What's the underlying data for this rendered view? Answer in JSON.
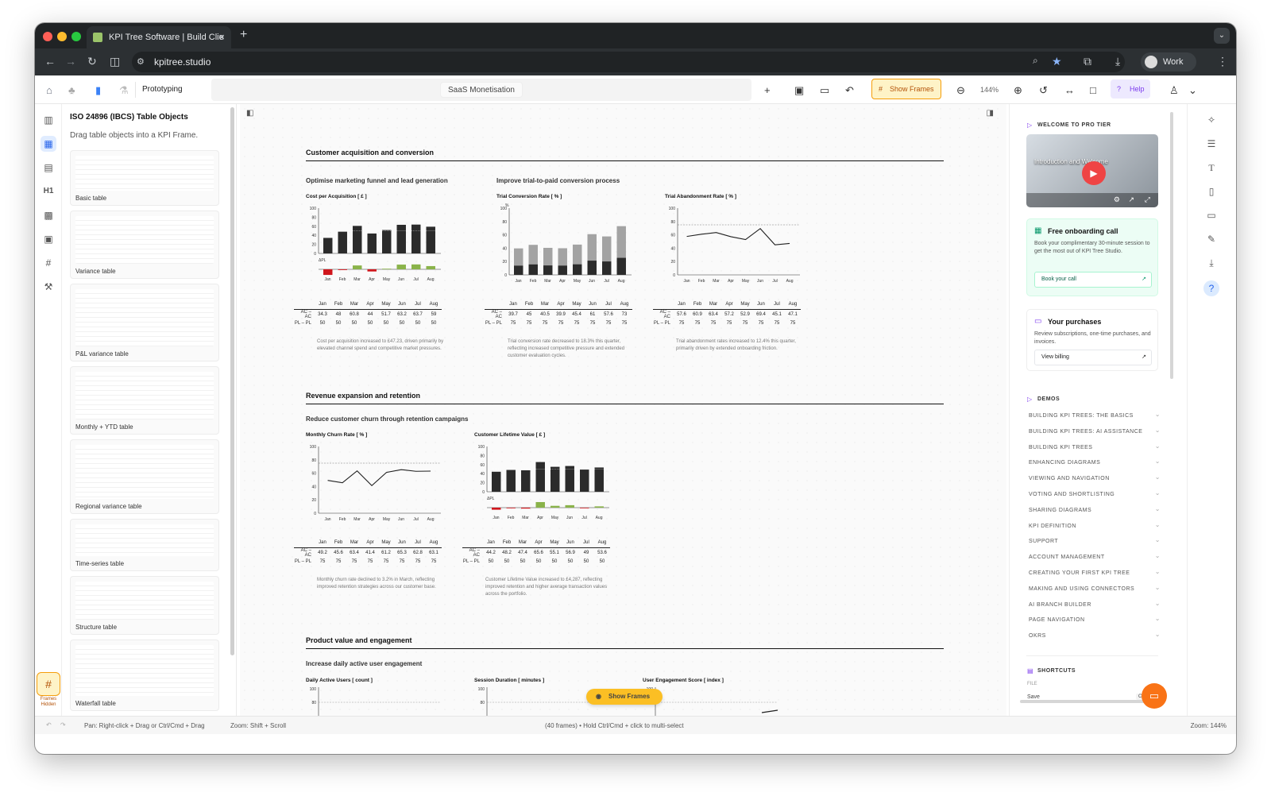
{
  "browser": {
    "tab_title": "KPI Tree Software | Build Clie",
    "url": "kpitree.studio",
    "profile": "Work"
  },
  "toolbar": {
    "prototyping": "Prototyping",
    "doc_title": "SaaS Monetisation",
    "show_frames": "Show Frames",
    "zoom": "144%",
    "help": "Help"
  },
  "panel": {
    "title": "ISO 24896 (IBCS) Table Objects",
    "subtitle": "Drag table objects into a KPI Frame.",
    "cards": [
      "Basic table",
      "Variance table",
      "P&L variance table",
      "Monthly + YTD table",
      "Regional variance table",
      "Time-series table",
      "Structure table",
      "Waterfall table"
    ]
  },
  "frames_hidden": "Frames\nHidden",
  "months": [
    "Jan",
    "Feb",
    "Mar",
    "Apr",
    "May",
    "Jun",
    "Jul",
    "Aug"
  ],
  "row_ac": "AC – AC",
  "row_pl": "PL – PL",
  "sections": [
    {
      "title": "Customer acquisition and conversion",
      "subtitles": [
        "Optimise marketing funnel and lead generation",
        "Improve trial-to-paid conversion process"
      ],
      "charts": [
        {
          "title": "Cost per Acquisition [ £ ]",
          "delta_label": "ΔPL",
          "ac": [
            "34.3",
            "48",
            "60.8",
            "44",
            "51.7",
            "63.2",
            "63.7",
            "59"
          ],
          "pl": [
            "50",
            "50",
            "50",
            "50",
            "50",
            "50",
            "50",
            "50"
          ],
          "note": "Cost per acquisition increased to £47.23, driven primarily by elevated channel spend and competitive market pressures."
        },
        {
          "title": "Trial Conversion Rate [ % ]",
          "unit": "%",
          "ac": [
            "39.7",
            "45",
            "40.5",
            "39.9",
            "45.4",
            "61",
            "57.6",
            "73"
          ],
          "pl": [
            "75",
            "75",
            "75",
            "75",
            "75",
            "75",
            "75",
            "75"
          ],
          "note": "Trial conversion rate decreased to 18.3% this quarter, reflecting increased competitive pressure and extended customer evaluation cycles."
        },
        {
          "title": "Trial Abandonment Rate [ % ]",
          "ac": [
            "57.6",
            "60.9",
            "63.4",
            "57.2",
            "52.9",
            "69.4",
            "45.1",
            "47.1"
          ],
          "pl": [
            "75",
            "75",
            "75",
            "75",
            "75",
            "75",
            "75",
            "75"
          ],
          "note": "Trial abandonment rates increased to 12.4% this quarter, primarily driven by extended onboarding friction."
        }
      ]
    },
    {
      "title": "Revenue expansion and retention",
      "subtitles": [
        "Reduce customer churn through retention campaigns"
      ],
      "charts": [
        {
          "title": "Monthly Churn Rate [ % ]",
          "ac": [
            "49.2",
            "45.6",
            "63.4",
            "41.4",
            "61.2",
            "65.3",
            "62.8",
            "63.1"
          ],
          "pl": [
            "75",
            "75",
            "75",
            "75",
            "75",
            "75",
            "75",
            "75"
          ],
          "note": "Monthly churn rate declined to 3.2% in March, reflecting improved retention strategies across our customer base."
        },
        {
          "title": "Customer Lifetime Value [ £ ]",
          "delta_label": "ΔPL",
          "ac": [
            "44.2",
            "48.2",
            "47.4",
            "65.6",
            "55.1",
            "56.9",
            "49",
            "53.6"
          ],
          "pl": [
            "50",
            "50",
            "50",
            "50",
            "50",
            "50",
            "50",
            "50"
          ],
          "note": "Customer Lifetime Value increased to £4,287, reflecting improved retention and higher average transaction values across the portfolio."
        }
      ]
    },
    {
      "title": "Product value and engagement",
      "subtitles": [
        "Increase daily active user engagement"
      ],
      "charts": [
        {
          "title": "Daily Active Users [ count ]"
        },
        {
          "title": "Session Duration [ minutes ]"
        },
        {
          "title": "User Engagement Score [ index ]"
        }
      ]
    }
  ],
  "axis_ticks": [
    "100",
    "80",
    "60",
    "40",
    "20",
    "0"
  ],
  "floating_show_frames": "Show Frames",
  "right": {
    "welcome": "WELCOME TO PRO TIER",
    "video_title": "Introduction and Welcome",
    "onboarding_title": "Free onboarding call",
    "onboarding_text": "Book your complimentary 30-minute session to get the most out of KPI Tree Studio.",
    "book_call": "Book your call",
    "purchases_title": "Your purchases",
    "purchases_text": "Review subscriptions, one-time purchases, and invoices.",
    "view_billing": "View billing",
    "demos": "DEMOS",
    "demo_items": [
      "BUILDING KPI TREES: THE BASICS",
      "BUILDING KPI TREES: AI ASSISTANCE",
      "BUILDING KPI TREES",
      "ENHANCING DIAGRAMS",
      "VIEWING AND NAVIGATION",
      "VOTING AND SHORTLISTING",
      "SHARING DIAGRAMS",
      "KPI DEFINITION",
      "SUPPORT",
      "ACCOUNT MANAGEMENT",
      "CREATING YOUR FIRST KPI TREE",
      "MAKING AND USING CONNECTORS",
      "AI BRANCH BUILDER",
      "PAGE NAVIGATION",
      "OKRS"
    ],
    "shortcuts": "SHORTCUTS",
    "file": "FILE",
    "save": "Save",
    "save_key": "Cmd+S"
  },
  "status": {
    "pan": "Pan: Right-click + Drag or Ctrl/Cmd + Drag",
    "zoom_hint": "Zoom: Shift + Scroll",
    "frames": "(40 frames) • Hold Ctrl/Cmd + click to multi-select",
    "zoom": "Zoom: 144%"
  },
  "colors": {
    "accent_orange": "#f97316",
    "bar_dark": "#2b2b2b",
    "bar_grey": "#9e9e9e",
    "good": "#8ab34a",
    "bad": "#d0161c",
    "highlight": "#fde68a"
  }
}
